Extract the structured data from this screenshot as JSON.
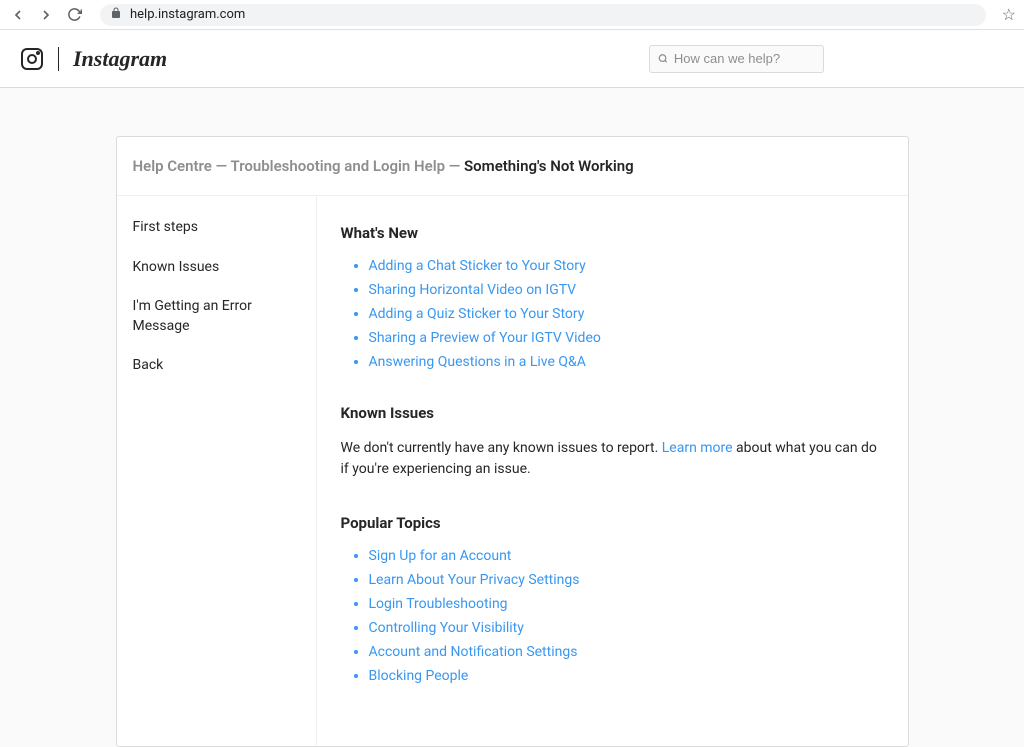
{
  "browser": {
    "url": "help.instagram.com"
  },
  "header": {
    "brand": "Instagram",
    "search_placeholder": "How can we help?"
  },
  "breadcrumb": {
    "part1": "Help Centre",
    "sep": " — ",
    "part2": "Troubleshooting and Login Help",
    "current": "Something's Not Working"
  },
  "sidebar": {
    "items": [
      "First steps",
      "Known Issues",
      "I'm Getting an Error Message",
      "Back"
    ]
  },
  "sections": {
    "whats_new": {
      "title": "What's New",
      "links": [
        "Adding a Chat Sticker to Your Story",
        "Sharing Horizontal Video on IGTV",
        "Adding a Quiz Sticker to Your Story",
        "Sharing a Preview of Your IGTV Video",
        "Answering Questions in a Live Q&A"
      ]
    },
    "known_issues": {
      "title": "Known Issues",
      "text_before": "We don't currently have any known issues to report. ",
      "link": "Learn more",
      "text_after": " about what you can do if you're experiencing an issue."
    },
    "popular_topics": {
      "title": "Popular Topics",
      "links": [
        "Sign Up for an Account",
        "Learn About Your Privacy Settings",
        "Login Troubleshooting",
        "Controlling Your Visibility",
        "Account and Notification Settings",
        "Blocking People"
      ]
    }
  }
}
